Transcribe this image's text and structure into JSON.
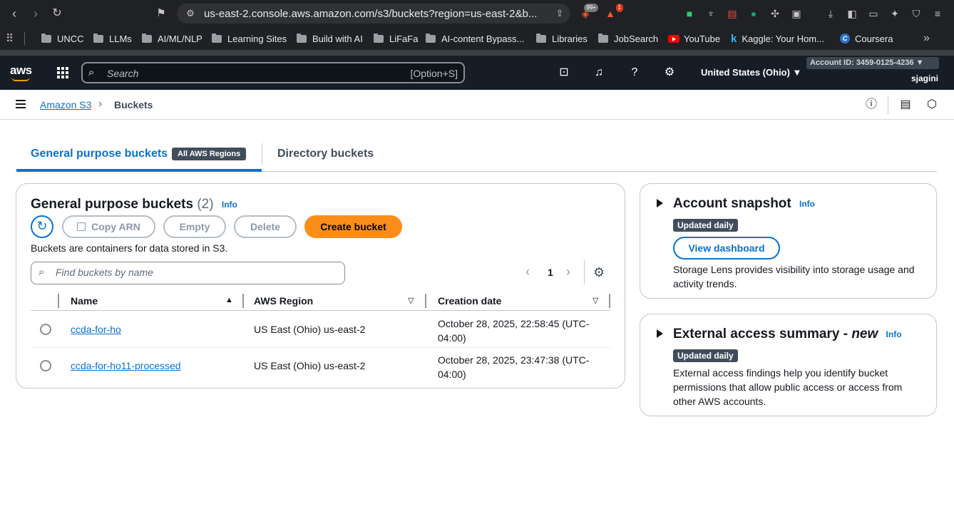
{
  "browser": {
    "url": "us-east-2.console.aws.amazon.com/s3/buckets?region=us-east-2&b...",
    "notif_badge": "99+",
    "alert_badge": "1",
    "bookmarks": [
      "UNCC",
      "LLMs",
      "AI/ML/NLP",
      "Learning Sites",
      "Build with AI",
      "LiFaFa",
      "AI-content Bypass...",
      "Libraries",
      "JobSearch",
      "YouTube",
      "Kaggle: Your Hom...",
      "Coursera"
    ]
  },
  "aws": {
    "logo": "aws",
    "search_placeholder": "Search",
    "search_shortcut": "[Option+S]",
    "region": "United States (Ohio) ▼",
    "account": "Account ID: 3459-0125-4236 ▼",
    "user": "sjagini"
  },
  "breadcrumb": {
    "parent": "Amazon S3",
    "current": "Buckets"
  },
  "tabs": {
    "active": "General purpose buckets",
    "active_pill": "All AWS Regions",
    "other": "Directory buckets"
  },
  "panel": {
    "title": "General purpose buckets",
    "count": "(2)",
    "info": "Info",
    "buttons": {
      "copy_arn": "Copy ARN",
      "empty": "Empty",
      "delete": "Delete",
      "create": "Create bucket"
    },
    "description": "Buckets are containers for data stored in S3.",
    "search_placeholder": "Find buckets by name",
    "page": "1",
    "columns": [
      "Name",
      "AWS Region",
      "Creation date"
    ],
    "rows": [
      {
        "name": "ccda-for-ho",
        "region": "US East (Ohio) us-east-2",
        "date": "October 28, 2025, 22:58:45 (UTC-04:00)"
      },
      {
        "name": "ccda-for-ho11-processed",
        "region": "US East (Ohio) us-east-2",
        "date": "October 28, 2025, 23:47:38 (UTC-04:00)"
      }
    ]
  },
  "snapshot": {
    "title": "Account snapshot",
    "info": "Info",
    "badge": "Updated daily",
    "button": "View dashboard",
    "description": "Storage Lens provides visibility into storage usage and activity trends."
  },
  "external": {
    "title": "External access summary - ",
    "title_new": "new",
    "info": "Info",
    "badge": "Updated daily",
    "description": "External access findings help you identify bucket permissions that allow public access or access from other AWS accounts."
  },
  "colors": {
    "accent": "#0972d3",
    "primary_button": "#fd8d19",
    "header_bg": "#161d26"
  }
}
